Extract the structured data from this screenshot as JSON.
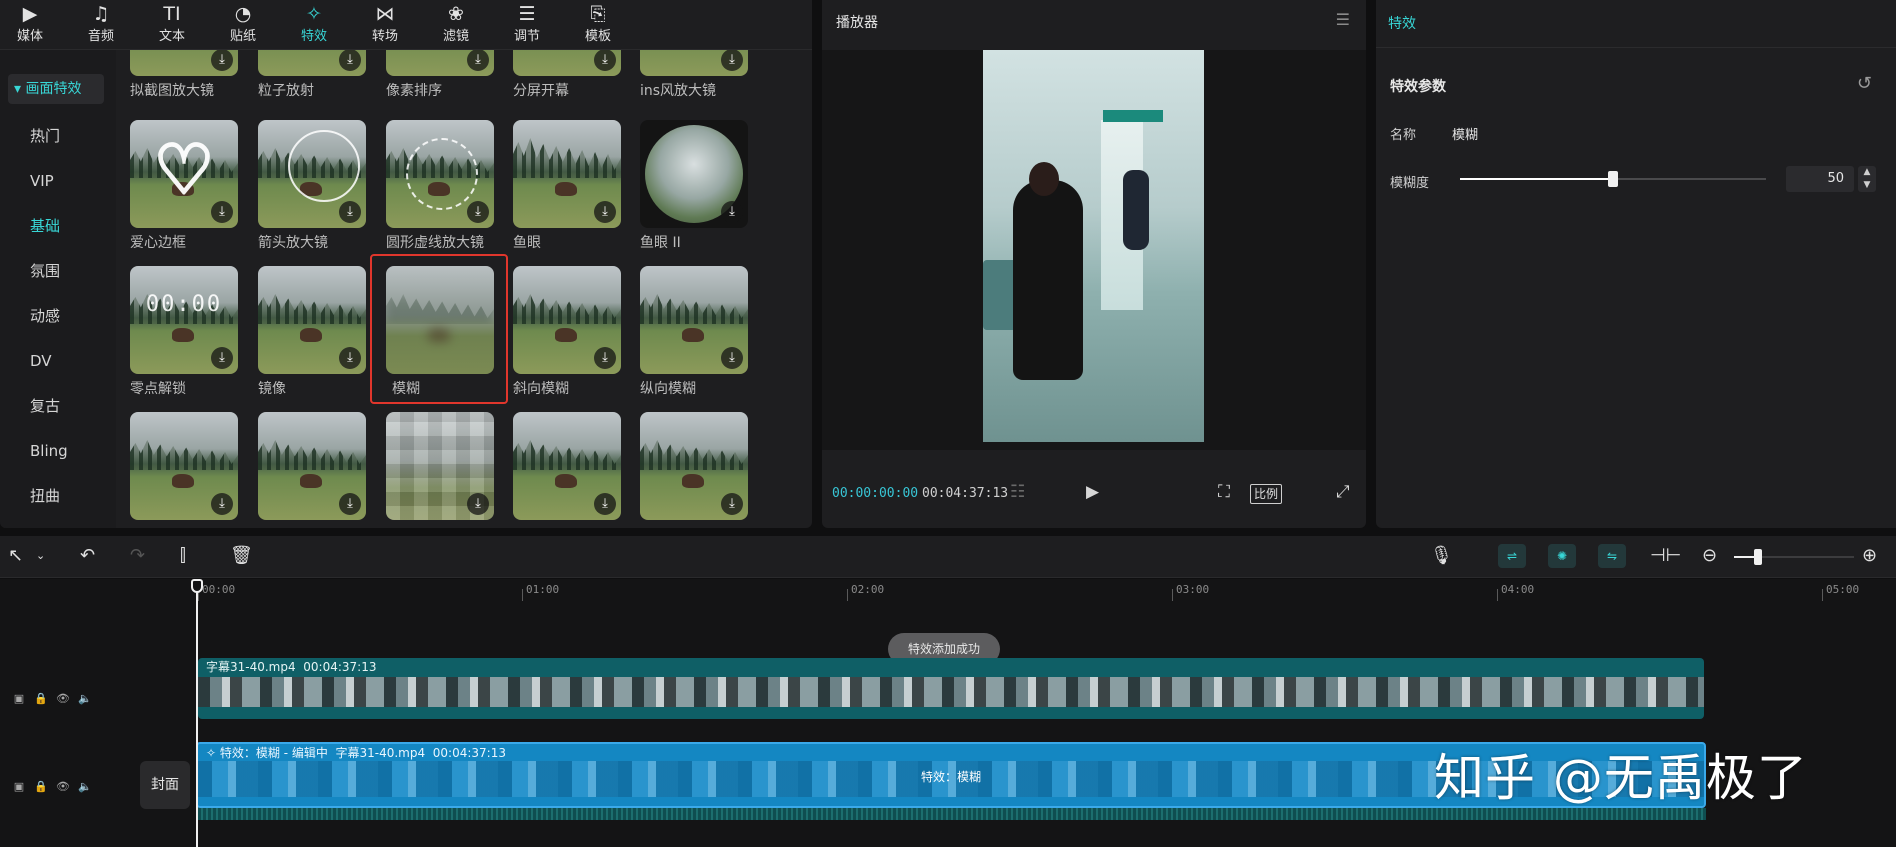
{
  "top_tabs": [
    {
      "label": "媒体",
      "icon": "media-icon",
      "glyph": "▶"
    },
    {
      "label": "音频",
      "icon": "audio-icon",
      "glyph": "♫"
    },
    {
      "label": "文本",
      "icon": "text-icon",
      "glyph": "TI"
    },
    {
      "label": "贴纸",
      "icon": "sticker-icon",
      "glyph": "◔"
    },
    {
      "label": "特效",
      "icon": "effects-icon",
      "glyph": "✧"
    },
    {
      "label": "转场",
      "icon": "transition-icon",
      "glyph": "⋈"
    },
    {
      "label": "滤镜",
      "icon": "filter-icon",
      "glyph": "❀"
    },
    {
      "label": "调节",
      "icon": "adjust-icon",
      "glyph": "☰"
    },
    {
      "label": "模板",
      "icon": "template-icon",
      "glyph": "⎘"
    }
  ],
  "active_tab": "特效",
  "side_nav": {
    "heading": "▾ 画面特效",
    "items": [
      "热门",
      "VIP",
      "基础",
      "氛围",
      "动感",
      "DV",
      "复古",
      "Bling",
      "扭曲"
    ],
    "active": "基础"
  },
  "effects": {
    "row0": [
      "拟截图放大镜",
      "粒子放射",
      "像素排序",
      "分屏开幕",
      "ins风放大镜"
    ],
    "row1": [
      "爱心边框",
      "箭头放大镜",
      "圆形虚线放大镜",
      "鱼眼",
      "鱼眼 II"
    ],
    "row2": [
      "零点解锁",
      "镜像",
      "模糊",
      "斜向模糊",
      "纵向模糊"
    ],
    "clock_text": "00:00",
    "download_glyph": "⤓",
    "selected": "模糊"
  },
  "player": {
    "title": "播放器",
    "current_time": "00:00:00:00",
    "total_time": "00:04:37:13",
    "ratio_label": "比例"
  },
  "props": {
    "tab_title": "特效",
    "section_title": "特效参数",
    "name_label": "名称",
    "name_value": "模糊",
    "blur_label": "模糊度",
    "blur_value": "50",
    "blur_fraction": 0.5
  },
  "timeline": {
    "ruler": [
      "00:00",
      "01:00",
      "02:00",
      "03:00",
      "04:00",
      "05:00"
    ],
    "toast": "特效添加成功",
    "main_clip_name": "字幕31-40.mp4",
    "main_clip_duration": "00:04:37:13",
    "effect_tag": "特效：模糊 - 编辑中",
    "effect_clip_name": "字幕31-40.mp4",
    "effect_clip_duration": "00:04:37:13",
    "effect_center_label": "特效：模糊",
    "cover_label": "封面",
    "zoom_fraction": 0.2
  },
  "watermark": "知乎 @无禹极了",
  "colors": {
    "accent": "#38d6d6",
    "selection": "#e0362c",
    "effect_clip": "#1487c2",
    "main_clip": "#0f5f66"
  }
}
